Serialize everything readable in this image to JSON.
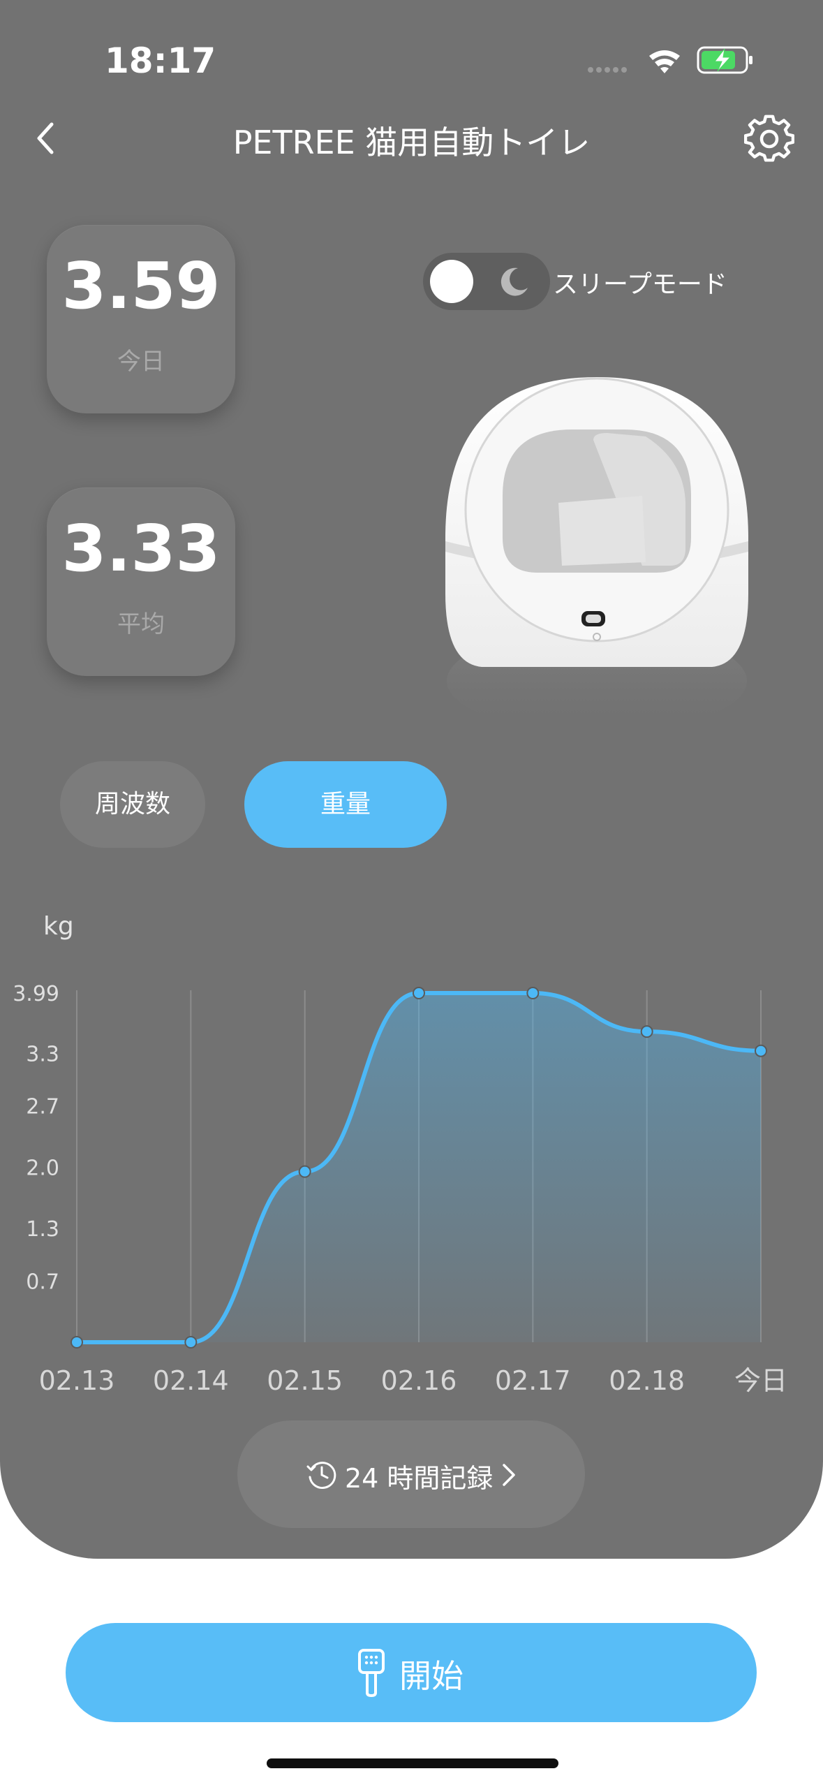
{
  "status_bar": {
    "time": "18:17"
  },
  "header": {
    "title": "PETREE 猫用自動トイレ",
    "back_icon": "chevron-left-icon",
    "settings_icon": "gear-icon"
  },
  "stats": {
    "today": {
      "value": "3.59",
      "label": "今日"
    },
    "average": {
      "value": "3.33",
      "label": "平均"
    }
  },
  "sleep_mode": {
    "label": "スリープモード",
    "enabled": false
  },
  "tabs": {
    "frequency": "周波数",
    "weight": "重量",
    "active": "weight"
  },
  "chart_data": {
    "type": "area",
    "unit_label": "kg",
    "categories": [
      "02.13",
      "02.14",
      "02.15",
      "02.16",
      "02.17",
      "02.18",
      "今日"
    ],
    "values": [
      0,
      0,
      1.95,
      3.99,
      3.99,
      3.55,
      3.33
    ],
    "y_ticks": [
      "3.99",
      "3.3",
      "2.7",
      "2.0",
      "1.3",
      "0.7"
    ],
    "ylim": [
      0,
      3.99
    ],
    "grid": "vertical",
    "color": "#4cb8f6"
  },
  "history": {
    "label": "24 時間記録"
  },
  "start_button": {
    "label": "開始"
  },
  "colors": {
    "panel": "#727272",
    "accent": "#58bdf7"
  }
}
